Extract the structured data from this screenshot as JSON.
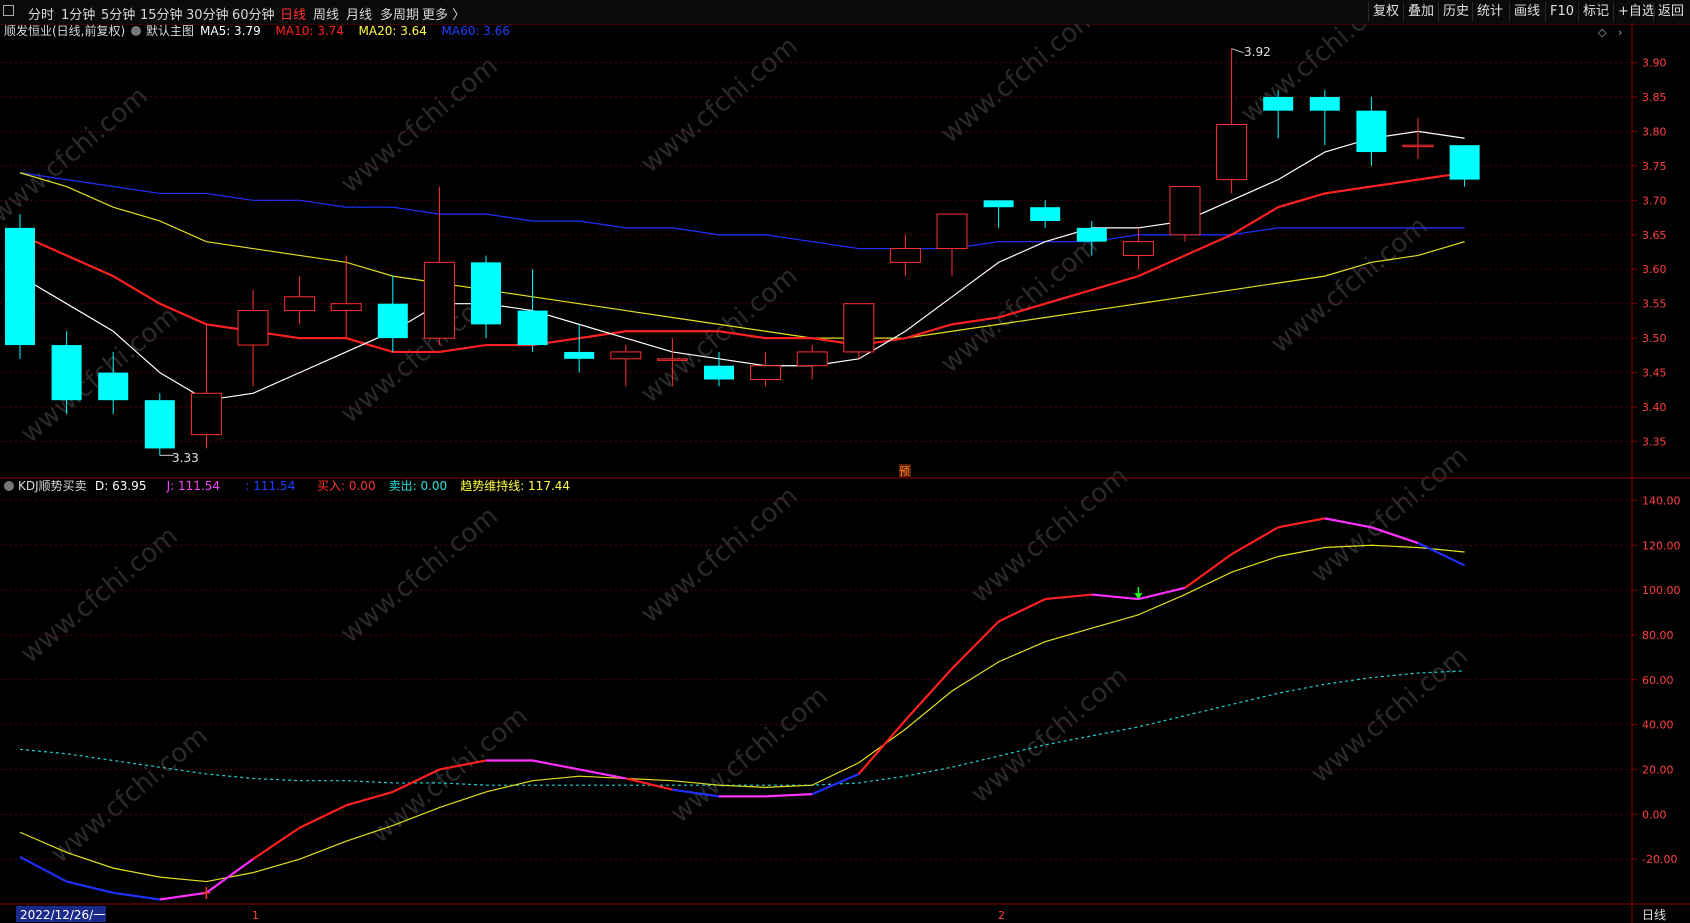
{
  "toolbar": {
    "left_icon": "menu-square-icon",
    "periods": [
      "分时",
      "1分钟",
      "5分钟",
      "15分钟",
      "30分钟",
      "60分钟",
      "日线",
      "周线",
      "月线",
      "多周期",
      "更多 〉"
    ],
    "active_period": "日线",
    "right_buttons": [
      "复权",
      "叠加",
      "历史",
      "统计",
      "画线",
      "F10",
      "标记",
      "+自选",
      "返回"
    ]
  },
  "main_panel": {
    "stock_title": "顺发恒业(日线,前复权)",
    "chart_name": "默认主图",
    "ma": [
      {
        "label": "MA5: 3.79",
        "color": "#ffffff"
      },
      {
        "label": "MA10: 3.74",
        "color": "#ff2020"
      },
      {
        "label": "MA20: 3.64",
        "color": "#ffff40"
      },
      {
        "label": "MA60: 3.66",
        "color": "#2040ff"
      }
    ],
    "max_label": "3.92",
    "min_label": "3.33",
    "pre_badge": "预",
    "y_ticks": [
      "3.90",
      "3.85",
      "3.80",
      "3.75",
      "3.70",
      "3.65",
      "3.60",
      "3.55",
      "3.50",
      "3.45",
      "3.40",
      "3.35"
    ]
  },
  "kdj_panel": {
    "name": "KDJ顺势买卖",
    "labels": [
      {
        "text": "D: 63.95",
        "color": "#ffffff"
      },
      {
        "text": "J: 111.54",
        "color": "#ff40ff"
      },
      {
        "text": ": 111.54",
        "color": "#2040ff"
      },
      {
        "text": "买入: 0.00",
        "color": "#ff3030"
      },
      {
        "text": "卖出: 0.00",
        "color": "#20e0e0"
      },
      {
        "text": "趋势维持线: 117.44",
        "color": "#ffff40"
      }
    ],
    "y_ticks": [
      "140.00",
      "120.00",
      "100.00",
      "80.00",
      "60.00",
      "40.00",
      "20.00",
      "0.00",
      "-20.00"
    ]
  },
  "bottom_bar": {
    "date_cursor": "2022/12/26/一",
    "month_marks": [
      "1",
      "2"
    ],
    "period_label": "日线"
  },
  "watermark": "www.cfchi.com",
  "colors": {
    "up": "#ff3030",
    "down": "#00ffff",
    "grid": "#5a0000",
    "ma5": "#ffffff",
    "ma10": "#ff2020",
    "ma20": "#e0e020",
    "ma60": "#2030ff"
  },
  "chart_data": {
    "type": "candlestick",
    "price_range": [
      3.3,
      3.95
    ],
    "candles": [
      {
        "o": 3.66,
        "h": 3.68,
        "l": 3.47,
        "c": 3.49
      },
      {
        "o": 3.49,
        "h": 3.51,
        "l": 3.39,
        "c": 3.41
      },
      {
        "o": 3.45,
        "h": 3.48,
        "l": 3.39,
        "c": 3.41
      },
      {
        "o": 3.41,
        "h": 3.42,
        "l": 3.33,
        "c": 3.34
      },
      {
        "o": 3.36,
        "h": 3.52,
        "l": 3.34,
        "c": 3.42
      },
      {
        "o": 3.49,
        "h": 3.57,
        "l": 3.43,
        "c": 3.54
      },
      {
        "o": 3.54,
        "h": 3.59,
        "l": 3.52,
        "c": 3.56
      },
      {
        "o": 3.54,
        "h": 3.62,
        "l": 3.5,
        "c": 3.55
      },
      {
        "o": 3.55,
        "h": 3.59,
        "l": 3.48,
        "c": 3.5
      },
      {
        "o": 3.5,
        "h": 3.72,
        "l": 3.49,
        "c": 3.61
      },
      {
        "o": 3.61,
        "h": 3.62,
        "l": 3.5,
        "c": 3.52
      },
      {
        "o": 3.54,
        "h": 3.6,
        "l": 3.48,
        "c": 3.49
      },
      {
        "o": 3.48,
        "h": 3.52,
        "l": 3.45,
        "c": 3.47
      },
      {
        "o": 3.47,
        "h": 3.49,
        "l": 3.43,
        "c": 3.48
      },
      {
        "o": 3.47,
        "h": 3.5,
        "l": 3.43,
        "c": 3.47
      },
      {
        "o": 3.46,
        "h": 3.48,
        "l": 3.43,
        "c": 3.44
      },
      {
        "o": 3.44,
        "h": 3.48,
        "l": 3.43,
        "c": 3.46
      },
      {
        "o": 3.46,
        "h": 3.49,
        "l": 3.44,
        "c": 3.48
      },
      {
        "o": 3.48,
        "h": 3.55,
        "l": 3.47,
        "c": 3.55
      },
      {
        "o": 3.61,
        "h": 3.65,
        "l": 3.59,
        "c": 3.63
      },
      {
        "o": 3.63,
        "h": 3.68,
        "l": 3.59,
        "c": 3.68
      },
      {
        "o": 3.7,
        "h": 3.7,
        "l": 3.66,
        "c": 3.69
      },
      {
        "o": 3.69,
        "h": 3.7,
        "l": 3.66,
        "c": 3.67
      },
      {
        "o": 3.66,
        "h": 3.67,
        "l": 3.62,
        "c": 3.64
      },
      {
        "o": 3.62,
        "h": 3.66,
        "l": 3.6,
        "c": 3.64
      },
      {
        "o": 3.65,
        "h": 3.72,
        "l": 3.64,
        "c": 3.72
      },
      {
        "o": 3.73,
        "h": 3.92,
        "l": 3.71,
        "c": 3.81
      },
      {
        "o": 3.85,
        "h": 3.86,
        "l": 3.79,
        "c": 3.83
      },
      {
        "o": 3.85,
        "h": 3.86,
        "l": 3.78,
        "c": 3.83
      },
      {
        "o": 3.83,
        "h": 3.85,
        "l": 3.75,
        "c": 3.77
      },
      {
        "o": 3.78,
        "h": 3.82,
        "l": 3.76,
        "c": 3.78
      },
      {
        "o": 3.78,
        "h": 3.78,
        "l": 3.72,
        "c": 3.73
      }
    ],
    "ma5": [
      3.59,
      3.55,
      3.51,
      3.45,
      3.41,
      3.42,
      3.45,
      3.48,
      3.51,
      3.55,
      3.55,
      3.54,
      3.52,
      3.5,
      3.48,
      3.47,
      3.46,
      3.46,
      3.47,
      3.51,
      3.56,
      3.61,
      3.64,
      3.66,
      3.66,
      3.67,
      3.7,
      3.73,
      3.77,
      3.79,
      3.8,
      3.79
    ],
    "ma10": [
      3.65,
      3.62,
      3.59,
      3.55,
      3.52,
      3.51,
      3.5,
      3.5,
      3.48,
      3.48,
      3.49,
      3.49,
      3.5,
      3.51,
      3.51,
      3.51,
      3.5,
      3.5,
      3.49,
      3.5,
      3.52,
      3.53,
      3.55,
      3.57,
      3.59,
      3.62,
      3.65,
      3.69,
      3.71,
      3.72,
      3.73,
      3.74
    ],
    "ma20": [
      3.74,
      3.72,
      3.69,
      3.67,
      3.64,
      3.63,
      3.62,
      3.61,
      3.59,
      3.58,
      3.57,
      3.56,
      3.55,
      3.54,
      3.53,
      3.52,
      3.51,
      3.5,
      3.5,
      3.5,
      3.51,
      3.52,
      3.53,
      3.54,
      3.55,
      3.56,
      3.57,
      3.58,
      3.59,
      3.61,
      3.62,
      3.64
    ],
    "ma60": [
      3.74,
      3.73,
      3.72,
      3.71,
      3.71,
      3.7,
      3.7,
      3.69,
      3.69,
      3.68,
      3.68,
      3.67,
      3.67,
      3.66,
      3.66,
      3.65,
      3.65,
      3.64,
      3.63,
      3.63,
      3.63,
      3.64,
      3.64,
      3.64,
      3.65,
      3.65,
      3.65,
      3.66,
      3.66,
      3.66,
      3.66,
      3.66
    ],
    "kdj_range": [
      -40,
      150
    ],
    "kdj_k": [
      -19,
      -30,
      -35,
      -38,
      -35,
      -20,
      -6,
      4,
      10,
      20,
      24,
      24,
      20,
      16,
      11,
      8,
      8,
      9,
      18,
      42,
      65,
      86,
      96,
      98,
      96,
      101,
      116,
      128,
      132,
      128,
      121,
      111
    ],
    "kdj_k_highlight": [
      3,
      4,
      10,
      11,
      12,
      15,
      16,
      23,
      24,
      28,
      29
    ],
    "kdj_trend": [
      -8,
      -17,
      -24,
      -28,
      -30,
      -26,
      -20,
      -12,
      -5,
      3,
      10,
      15,
      17,
      16,
      15,
      13,
      12,
      13,
      23,
      38,
      55,
      68,
      77,
      83,
      89,
      98,
      108,
      115,
      119,
      120,
      119,
      117
    ],
    "kdj_d": [
      29,
      27,
      24,
      21,
      18,
      16,
      15,
      15,
      14,
      14,
      13,
      13,
      13,
      13,
      13,
      13,
      13,
      13,
      14,
      17,
      21,
      26,
      31,
      35,
      39,
      44,
      49,
      54,
      58,
      61,
      63,
      64
    ],
    "signals": [
      {
        "index": 4,
        "type": "buy"
      },
      {
        "index": 24,
        "type": "sell"
      }
    ]
  }
}
